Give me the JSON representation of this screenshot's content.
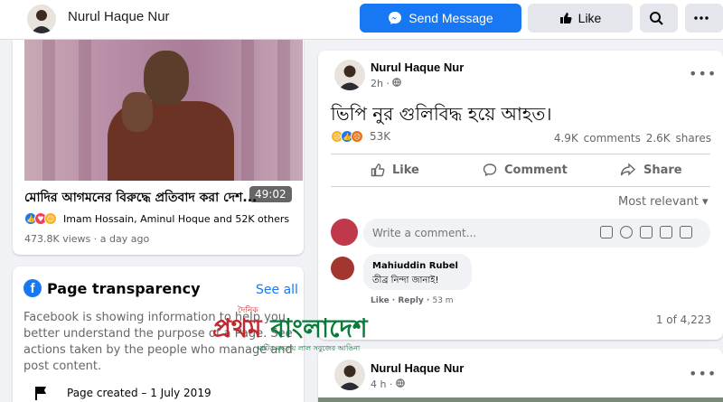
{
  "topbar": {
    "page_name": "Nurul Haque Nur",
    "send_message_label": "Send Message",
    "like_label": "Like",
    "search_icon": "search-icon",
    "more_icon": "more-icon"
  },
  "video": {
    "duration": "49:02",
    "title": "মোদির আগমনের বিরুদ্ধে প্রতিবাদ করা দেশ...",
    "reaction_names": "Imam Hossain, Aminul Hoque and 52K others",
    "meta": "473.8K views · a day ago"
  },
  "transparency": {
    "title": "Page transparency",
    "see_all": "See all",
    "description": "Facebook is showing information to help you better understand the purpose of a Page. See actions taken by the people who manage and post content.",
    "page_created": "Page created – 1 July 2019"
  },
  "post": {
    "author": "Nurul Haque Nur",
    "time": "2h · ",
    "text": "ভিপি নুর গুলিবিদ্ধ হয়ে আহত।",
    "reaction_count": "53K",
    "stats": "4.9K comments 2.6K shares",
    "like_label": "Like",
    "comment_label": "Comment",
    "share_label": "Share",
    "sort_label": "Most relevant ▾",
    "comment_placeholder": "Write a comment...",
    "comment": {
      "name": "Mahiuddin Rubel",
      "text": "তীব্র নিন্দা জানাই!",
      "like": "Like",
      "reply": "Reply",
      "time": "53 m"
    },
    "pager": "1 of 4,223"
  },
  "post2": {
    "author": "Nurul Haque Nur",
    "time": "4 h · "
  },
  "watermark": {
    "small_top": "দৈনিক",
    "name_red": "প্রথম ",
    "name_green": "বাংলাদেশ",
    "tagline": "মাটির মমতায় লাল সবুজের আঙিনা"
  },
  "colors": {
    "accent": "#1877f2",
    "background": "#f0f2f5",
    "watermark_red": "#c1272d",
    "watermark_green": "#0a7a3a"
  }
}
